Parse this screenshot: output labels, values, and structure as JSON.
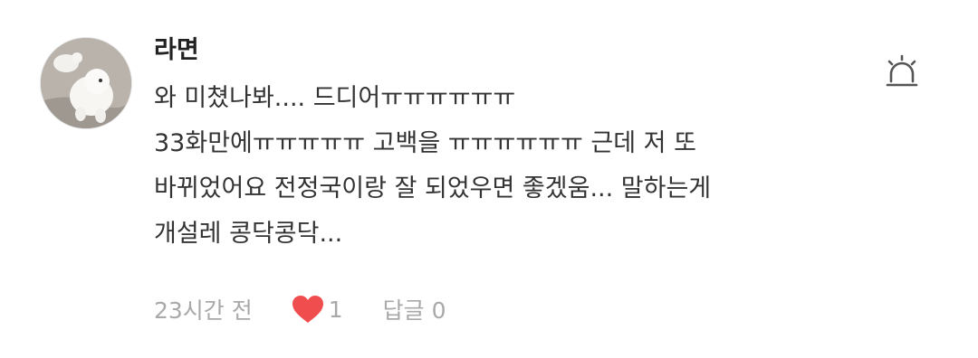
{
  "comment": {
    "author": "라면",
    "lines": [
      "와 미쳤나봐.... 드디어ㅠㅠㅠㅠㅠㅠ",
      "33화만에ㅠㅠㅠㅠㅠ  고백을 ㅠㅠㅠㅠㅠㅠ 근데 저 또",
      "바뀌었어요 전정국이랑 잘 되었우면 좋겠움... 말하는게",
      "개설레 콩닥콩닥..."
    ],
    "time": "23시간 전",
    "like_count": "1",
    "reply_label": "답글 0"
  },
  "icons": {
    "like": "heart-icon",
    "report": "siren-icon",
    "avatar": "dog-photo"
  },
  "colors": {
    "heart": "#f04e4e",
    "meta_text": "#a9a9a9",
    "author_text": "#222222",
    "body_text": "#333333"
  }
}
